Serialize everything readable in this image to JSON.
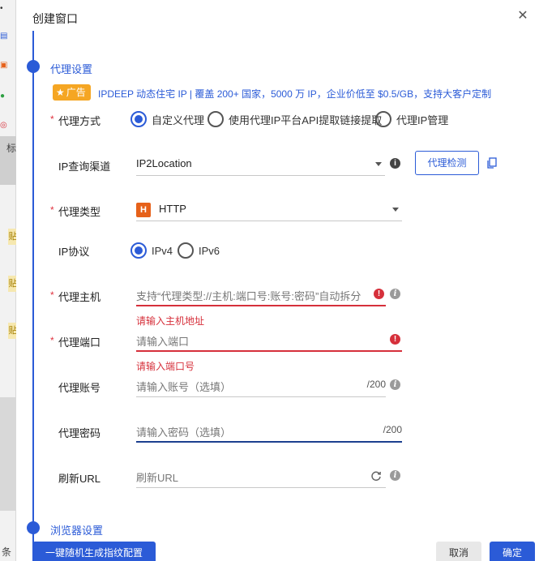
{
  "background": {
    "left_labels": [
      "标",
      "条"
    ],
    "tags": [
      "贴",
      "贴",
      "贴"
    ]
  },
  "dialog": {
    "title": "创建窗口",
    "section_proxy": "代理设置",
    "section_next": "浏览器设置"
  },
  "ad": {
    "badge": "广告",
    "text": "IPDEEP 动态住宅 IP | 覆盖 200+ 国家，5000 万 IP，企业价低至 $0.5/GB，支持大客户定制"
  },
  "form": {
    "proxy_method": {
      "label": "代理方式",
      "options": [
        "自定义代理",
        "使用代理IP平台API提取链接提取",
        "代理IP管理"
      ],
      "selected": "自定义代理"
    },
    "ip_channel": {
      "label": "IP查询渠道",
      "value": "IP2Location",
      "check_button": "代理检测"
    },
    "proxy_type": {
      "label": "代理类型",
      "icon_letter": "H",
      "value": "HTTP"
    },
    "ip_protocol": {
      "label": "IP协议",
      "options": [
        "IPv4",
        "IPv6"
      ],
      "selected": "IPv4"
    },
    "proxy_host": {
      "label": "代理主机",
      "placeholder": "支持“代理类型://主机:端口号:账号:密码”自动拆分",
      "error": "请输入主机地址"
    },
    "proxy_port": {
      "label": "代理端口",
      "placeholder": "请输入端口",
      "error": "请输入端口号"
    },
    "proxy_account": {
      "label": "代理账号",
      "placeholder": "请输入账号（选填）",
      "counter": "/200"
    },
    "proxy_password": {
      "label": "代理密码",
      "placeholder": "请输入密码（选填）",
      "counter": "/200"
    },
    "refresh_url": {
      "label": "刷新URL",
      "placeholder": "刷新URL"
    }
  },
  "footer": {
    "random_button": "一键随机生成指纹配置",
    "cancel_button": "取消",
    "ok_button": "确定"
  },
  "colors": {
    "accent": "#2b5bd7",
    "error": "#d6303b",
    "ad_badge": "#f5a623",
    "http_icon": "#e6611a"
  }
}
